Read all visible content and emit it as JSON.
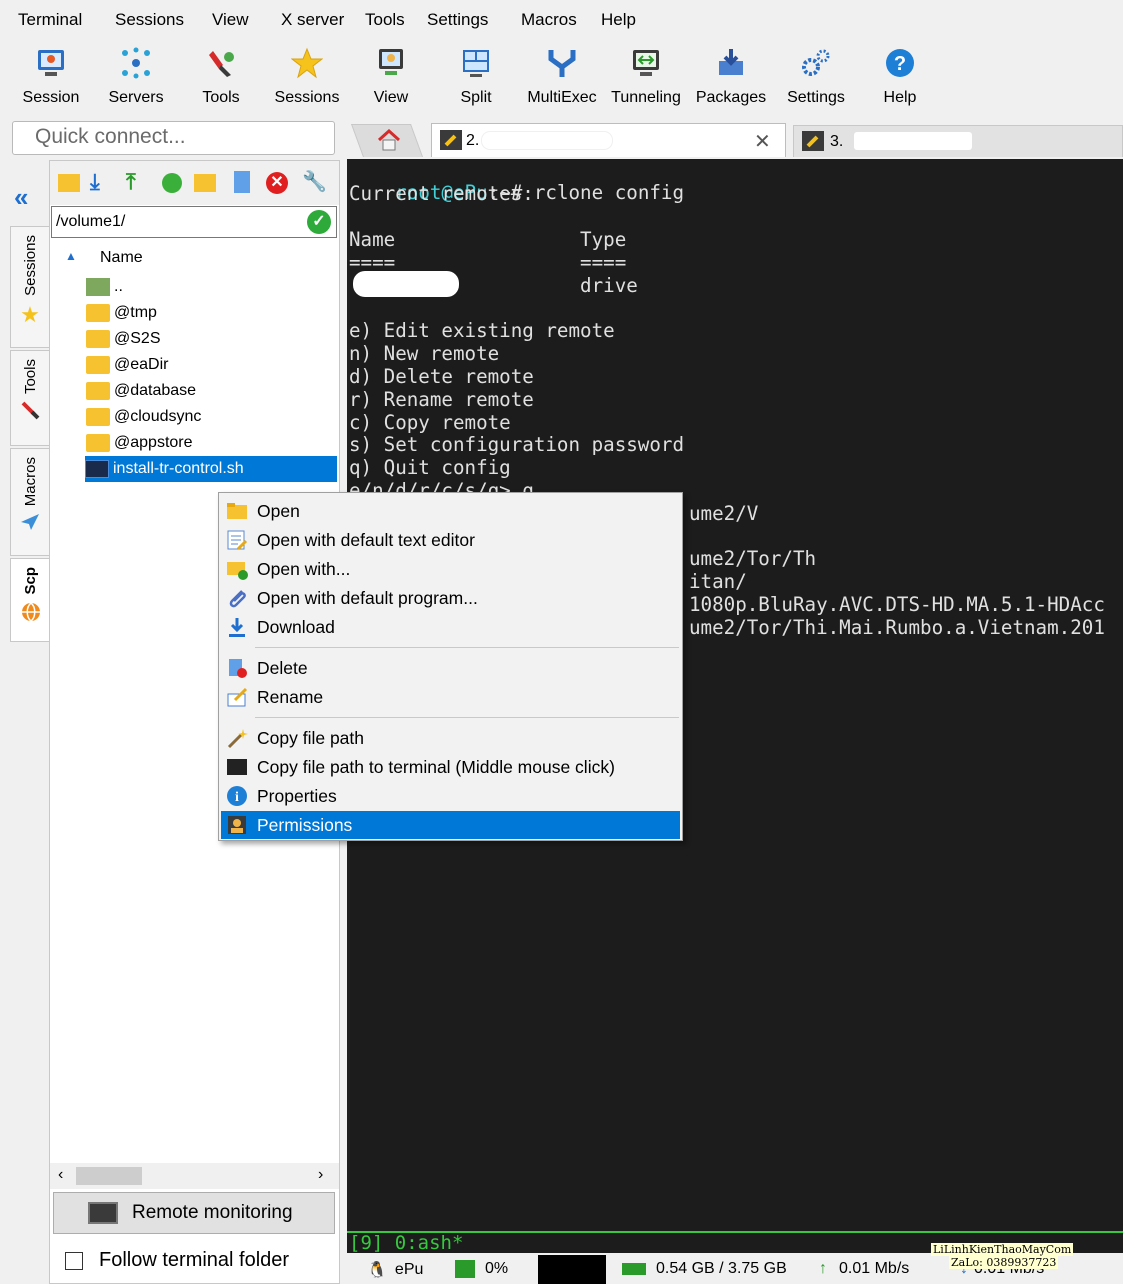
{
  "menubar": [
    "Terminal",
    "Sessions",
    "View",
    "X server",
    "Tools",
    "Settings",
    "Macros",
    "Help"
  ],
  "toolbar": [
    {
      "label": "Session",
      "icon": "session-icon"
    },
    {
      "label": "Servers",
      "icon": "servers-icon"
    },
    {
      "label": "Tools",
      "icon": "tools-icon"
    },
    {
      "label": "Sessions",
      "icon": "star-icon"
    },
    {
      "label": "View",
      "icon": "view-icon"
    },
    {
      "label": "Split",
      "icon": "split-icon"
    },
    {
      "label": "MultiExec",
      "icon": "multiexec-icon"
    },
    {
      "label": "Tunneling",
      "icon": "tunneling-icon"
    },
    {
      "label": "Packages",
      "icon": "packages-icon"
    },
    {
      "label": "Settings",
      "icon": "settings-icon"
    },
    {
      "label": "Help",
      "icon": "help-icon"
    }
  ],
  "quick_connect": {
    "placeholder": "Quick connect..."
  },
  "tabs": {
    "active_prefix": "2.",
    "inactive_prefix": "3."
  },
  "vtabs": {
    "sessions": "Sessions",
    "tools": "Tools",
    "macros": "Macros",
    "scp": "Scp"
  },
  "sidebar": {
    "path": "/volume1/",
    "header_name": "Name",
    "files": [
      {
        "name": "..",
        "type": "up"
      },
      {
        "name": "@tmp",
        "type": "folder"
      },
      {
        "name": "@S2S",
        "type": "folder"
      },
      {
        "name": "@eaDir",
        "type": "folder"
      },
      {
        "name": "@database",
        "type": "folder"
      },
      {
        "name": "@cloudsync",
        "type": "folder"
      },
      {
        "name": "@appstore",
        "type": "folder"
      },
      {
        "name": "install-tr-control.sh",
        "type": "script",
        "selected": true
      }
    ],
    "remote_monitoring": "Remote monitoring",
    "follow_terminal_folder": "Follow terminal folder"
  },
  "terminal": {
    "prompt": "root@ePu",
    "prompt_rest": ":~# rclone config",
    "lines": [
      "Current remotes:",
      "",
      "Name                Type",
      "====                ====",
      "                    drive",
      "",
      "e) Edit existing remote",
      "n) New remote",
      "d) Delete remote",
      "r) Rename remote",
      "c) Copy remote",
      "s) Set configuration password",
      "q) Quit config",
      "e/n/d/r/c/s/q> q"
    ],
    "partial_lines": [
      {
        "text": "ume2/V",
        "row": 15
      },
      {
        "text": "ume2/Tor/Th",
        "row": 17
      },
      {
        "text": "itan/",
        "row": 18
      },
      {
        "text": "1080p.BluRay.AVC.DTS-HD.MA.5.1-HDAcc",
        "row": 19
      },
      {
        "text": "ume2/Tor/Thi.Mai.Rumbo.a.Vietnam.201",
        "row": 20
      }
    ],
    "status_line": "[9] 0:ash*"
  },
  "statusbar": {
    "host": "ePu",
    "cpu": "0%",
    "memory": "0.54 GB / 3.75 GB",
    "upload": "0.01 Mb/s",
    "download": "0.01 Mb/s",
    "watermark_1": "LiLinhKienThaoMayCom",
    "watermark_2": "ZaLo: 0389937723"
  },
  "context_menu": [
    {
      "label": "Open",
      "icon": "folder-open-icon"
    },
    {
      "label": "Open with default text editor",
      "icon": "text-editor-icon"
    },
    {
      "label": "Open with...",
      "icon": "open-with-icon"
    },
    {
      "label": "Open with default program...",
      "icon": "paperclip-icon"
    },
    {
      "label": "Download",
      "icon": "download-icon"
    },
    {
      "label": "Delete",
      "icon": "delete-icon"
    },
    {
      "label": "Rename",
      "icon": "rename-icon"
    },
    {
      "label": "Copy file path",
      "icon": "magic-wand-icon"
    },
    {
      "label": "Copy file path to terminal (Middle mouse click)",
      "icon": "terminal-icon"
    },
    {
      "label": "Properties",
      "icon": "info-icon"
    },
    {
      "label": "Permissions",
      "icon": "permissions-icon",
      "selected": true
    }
  ],
  "colors": {
    "terminal_bg": "#1c1c1c",
    "terminal_fg": "#e0e0e0",
    "prompt": "#3fd0d8",
    "status_green": "#36c83e",
    "selection": "#0078d7"
  }
}
